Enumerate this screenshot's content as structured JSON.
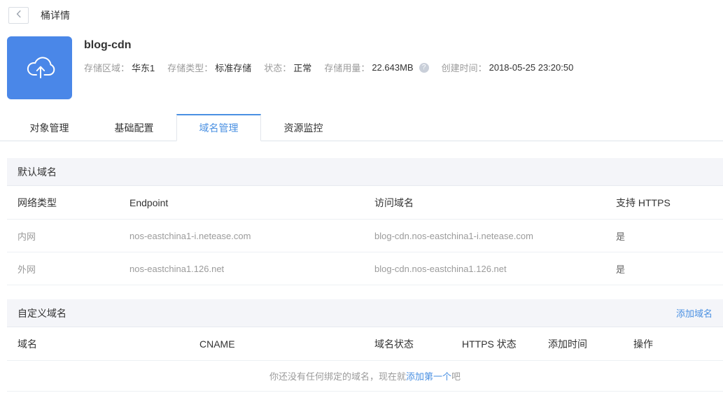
{
  "topbar": {
    "title": "桶详情"
  },
  "header": {
    "bucket_name": "blog-cdn",
    "meta": [
      {
        "label": "存储区域：",
        "value": "华东1"
      },
      {
        "label": "存储类型：",
        "value": "标准存储"
      },
      {
        "label": "状态：",
        "value": "正常"
      },
      {
        "label": "存储用量：",
        "value": "22.643MB"
      },
      {
        "label": "创建时间：",
        "value": "2018-05-25 23:20:50"
      }
    ]
  },
  "tabs": [
    {
      "label": "对象管理"
    },
    {
      "label": "基础配置"
    },
    {
      "label": "域名管理"
    },
    {
      "label": "资源监控"
    }
  ],
  "active_tab": "域名管理",
  "default_domains": {
    "section_title": "默认域名",
    "columns": [
      "网络类型",
      "Endpoint",
      "访问域名",
      "支持 HTTPS"
    ],
    "rows": [
      {
        "network_type": "内网",
        "endpoint": "nos-eastchina1-i.netease.com",
        "access_domain": "blog-cdn.nos-eastchina1-i.netease.com",
        "https": "是"
      },
      {
        "network_type": "外网",
        "endpoint": "nos-eastchina1.126.net",
        "access_domain": "blog-cdn.nos-eastchina1.126.net",
        "https": "是"
      }
    ]
  },
  "custom_domains": {
    "section_title": "自定义域名",
    "add_domain_label": "添加域名",
    "columns": [
      "域名",
      "CNAME",
      "域名状态",
      "HTTPS 状态",
      "添加时间",
      "操作"
    ],
    "empty": {
      "text_before": "你还没有任何绑定的域名，现在就",
      "link_text": "添加第一个",
      "text_after": "吧"
    }
  },
  "icons": {
    "help_glyph": "?"
  },
  "colors": {
    "accent": "#4a90e2",
    "bucket_icon_bg": "#4a87e8"
  }
}
